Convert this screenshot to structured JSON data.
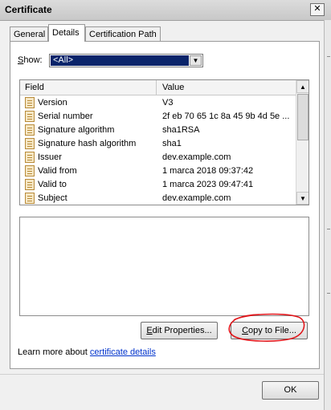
{
  "window": {
    "title": "Certificate",
    "close_glyph": "✕"
  },
  "tabs": [
    {
      "label": "General",
      "active": false
    },
    {
      "label": "Details",
      "active": true
    },
    {
      "label": "Certification Path",
      "active": false
    }
  ],
  "show": {
    "label": "Show:",
    "selected": "<All>",
    "arrow_glyph": "▼"
  },
  "list": {
    "columns": {
      "field": "Field",
      "value": "Value"
    },
    "rows": [
      {
        "field": "Version",
        "value": "V3"
      },
      {
        "field": "Serial number",
        "value": "2f eb 70 65 1c 8a 45 9b 4d 5e ..."
      },
      {
        "field": "Signature algorithm",
        "value": "sha1RSA"
      },
      {
        "field": "Signature hash algorithm",
        "value": "sha1"
      },
      {
        "field": "Issuer",
        "value": "dev.example.com"
      },
      {
        "field": "Valid from",
        "value": "1 marca 2018 09:37:42"
      },
      {
        "field": "Valid to",
        "value": "1 marca 2023 09:47:41"
      },
      {
        "field": "Subject",
        "value": "dev.example.com"
      }
    ],
    "scroll_up_glyph": "▲",
    "scroll_down_glyph": "▼"
  },
  "detail_text": "",
  "buttons": {
    "edit_properties": "Edit Properties...",
    "copy_to_file": "Copy to File...",
    "ok": "OK"
  },
  "learn_more": {
    "prefix": "Learn more about ",
    "link": "certificate details"
  },
  "annotation_color": "#e0161b"
}
